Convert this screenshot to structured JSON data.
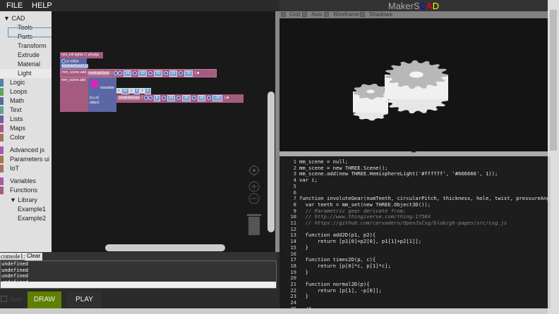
{
  "menu": {
    "file": "FILE",
    "help": "HELP"
  },
  "sidebar": {
    "items": [
      {
        "label": "▼ CAD",
        "indent": 0,
        "color": null
      },
      {
        "label": "Tools",
        "indent": 2,
        "color": null
      },
      {
        "label": "Parts",
        "indent": 2,
        "color": null
      },
      {
        "label": "Transform",
        "indent": 2,
        "color": null
      },
      {
        "label": "Extrude",
        "indent": 2,
        "color": null
      },
      {
        "label": "Material",
        "indent": 2,
        "color": null
      },
      {
        "label": "Light",
        "indent": 2,
        "color": null
      },
      {
        "label": "Logic",
        "indent": 1,
        "color": "#5b80a5"
      },
      {
        "label": "Loops",
        "indent": 1,
        "color": "#5ba55b"
      },
      {
        "label": "Math",
        "indent": 1,
        "color": "#5b67a5"
      },
      {
        "label": "Text",
        "indent": 1,
        "color": "#5ba58c"
      },
      {
        "label": "Lists",
        "indent": 1,
        "color": "#745ba5"
      },
      {
        "label": "Maps",
        "indent": 1,
        "color": "#a55b80"
      },
      {
        "label": "Color",
        "indent": 1,
        "color": "#a5745b"
      },
      {
        "label": "Advanced js",
        "indent": 1,
        "color": "#a55bb0"
      },
      {
        "label": "Parameters ui",
        "indent": 1,
        "color": "#a5745b"
      },
      {
        "label": "IoT",
        "indent": 1,
        "color": "#a5745b"
      },
      {
        "label": "Variables",
        "indent": 1,
        "color": "#a55ba5"
      },
      {
        "label": "Functions",
        "indent": 1,
        "color": "#a55b80"
      },
      {
        "label": "▼ Library",
        "indent": 1,
        "color": null
      },
      {
        "label": "Example1",
        "indent": 2,
        "color": null
      },
      {
        "label": "Example2",
        "indent": 2,
        "color": null
      }
    ]
  },
  "blocks": {
    "init": "mm_init lights",
    "physijs": "physijs",
    "js_editor": "js editor",
    "js_file": "involuteGear2.js",
    "scene_add_1": "mm_scene.add",
    "scene_add_2": "mm_scene.add",
    "gear1": {
      "name": "involuteGear",
      "params": [
        "15",
        "10",
        "20",
        "10",
        "15"
      ]
    },
    "translate": "translate",
    "xyz": "[x,y,z]",
    "object": "object",
    "xyz_values": {
      "x": "50",
      "y": "0",
      "z": "0"
    },
    "gear2": {
      "name": "involuteGear",
      "params": [
        "8",
        "10",
        "20",
        "10",
        "-15"
      ]
    }
  },
  "viewer": {
    "title_a": "MakerS",
    "title_c": "C",
    "title_ad": "A",
    "title_d": "D",
    "colors": {
      "c": "#0000ff",
      "a": "#ff0000",
      "d": "#ffff00"
    },
    "checks": [
      "Grid",
      "Axis",
      "Wireframe",
      "Shadows"
    ]
  },
  "console": {
    "label": "console1:",
    "clear": "Clear",
    "lines": [
      "undefined",
      "undefined",
      "undefined",
      "undefined"
    ]
  },
  "controls": {
    "auto": "Auto",
    "draw": "DRAW",
    "play": "PLAY",
    "accent": "#5e7f00"
  },
  "code": [
    "mm_scene = null;",
    "mm_scene = new THREE.Scene();",
    "mm_scene.add(new THREE.HemisphereLight('#ffffff', '#666666', 1));",
    "var i;",
    "",
    "",
    "function involuteGear(numTeeth, circularPitch, thickness, hole, twist, pressureAngle,",
    "  var teeth = mm_set(new THREE.Object3D());",
    "  // Parametric gear derivate from:",
    "  // http://www.thingiverse.com/thing:17584",
    "  // https://github.com/carvadero/OpenJsCsg/blob/gh-pages/src/csg.js",
    "",
    "  function add2D(p1, p2){",
    "      return [p1[0]+p2[0], p1[1]+p2[1]];",
    "  }",
    "",
    "  function times2D(p, c){",
    "      return [p[0]*c, p[1]*c];",
    "  }",
    "",
    "  function normal2D(p){",
    "      return [p[1], -p[0]];",
    "  }",
    "",
    "  /*"
  ]
}
